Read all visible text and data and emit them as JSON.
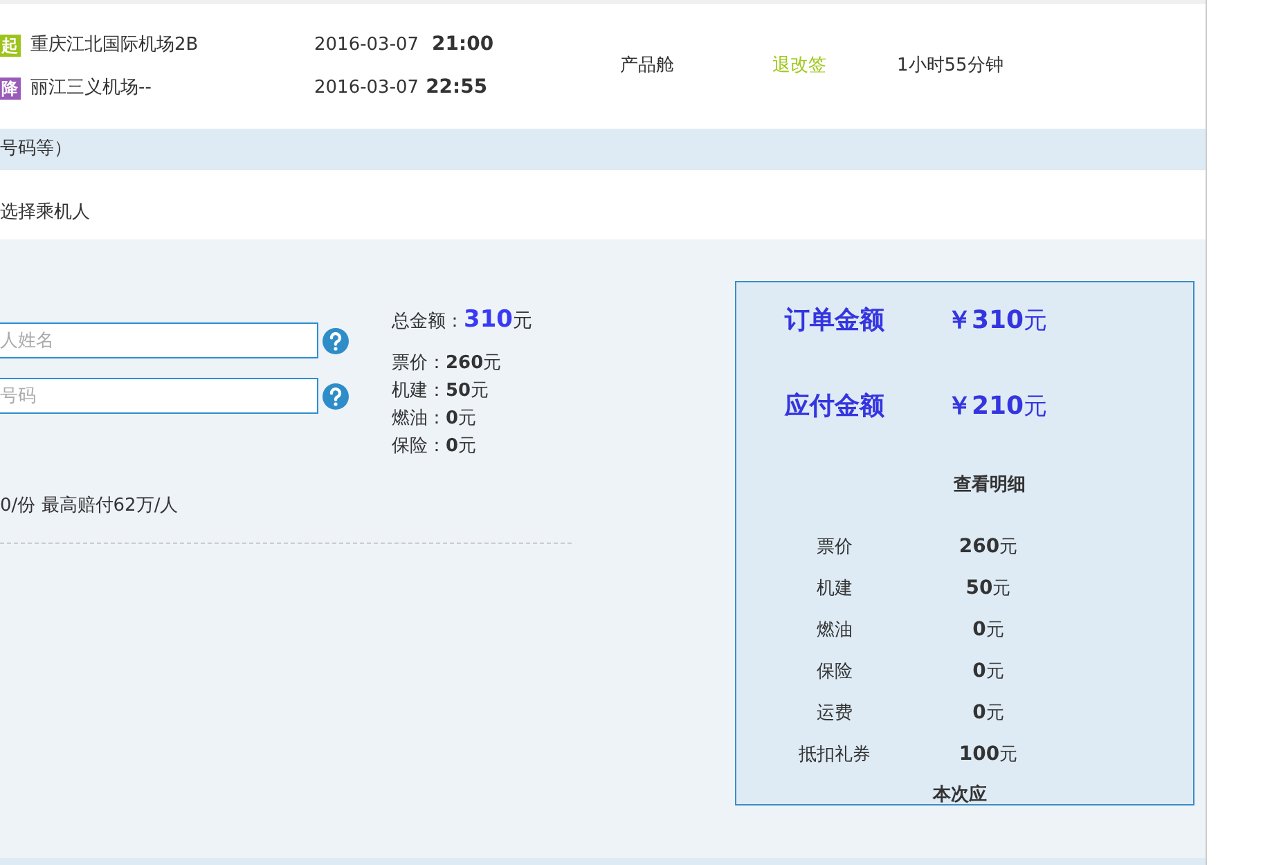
{
  "flight": {
    "segments": [
      {
        "kind": "depart",
        "badge": "起",
        "airport": "重庆江北国际机场2B",
        "date": "2016-03-07",
        "time": "21:00"
      },
      {
        "kind": "arrive",
        "badge": "降",
        "airport": "丽江三义机场--",
        "date": "2016-03-07",
        "time": "22:55"
      }
    ],
    "cabin": "产品舱",
    "rules_link": "退改签",
    "duration": "1小时55分钟"
  },
  "notice_band": "号码等）",
  "passenger_heading": "选择乘机人",
  "form": {
    "fields": [
      {
        "placeholder": "人姓名"
      },
      {
        "placeholder": "号码"
      }
    ],
    "insurance_text": "0/份 最高赔付62万/人"
  },
  "summary": {
    "total_label": "总金额：",
    "total_value": "310",
    "total_unit": "元",
    "lines": [
      {
        "label": "票价：",
        "value": "260",
        "unit": "元"
      },
      {
        "label": "机建：",
        "value": "50",
        "unit": "元"
      },
      {
        "label": "燃油：",
        "value": "0",
        "unit": "元"
      },
      {
        "label": "保险：",
        "value": "0",
        "unit": "元"
      }
    ]
  },
  "order_box": {
    "amounts": [
      {
        "label": "订单金额",
        "value": "￥310",
        "unit": "元"
      },
      {
        "label": "应付金额",
        "value": "￥210",
        "unit": "元"
      }
    ],
    "details_link": "查看明细",
    "rows": [
      {
        "label": "票价",
        "value": "260",
        "unit": "元"
      },
      {
        "label": "机建",
        "value": "50",
        "unit": "元"
      },
      {
        "label": "燃油",
        "value": "0",
        "unit": "元"
      },
      {
        "label": "保险",
        "value": "0",
        "unit": "元"
      },
      {
        "label": "运费",
        "value": "0",
        "unit": "元"
      },
      {
        "label": "抵扣礼券",
        "value": "100",
        "unit": "元"
      }
    ],
    "payable_text": "本次应"
  }
}
